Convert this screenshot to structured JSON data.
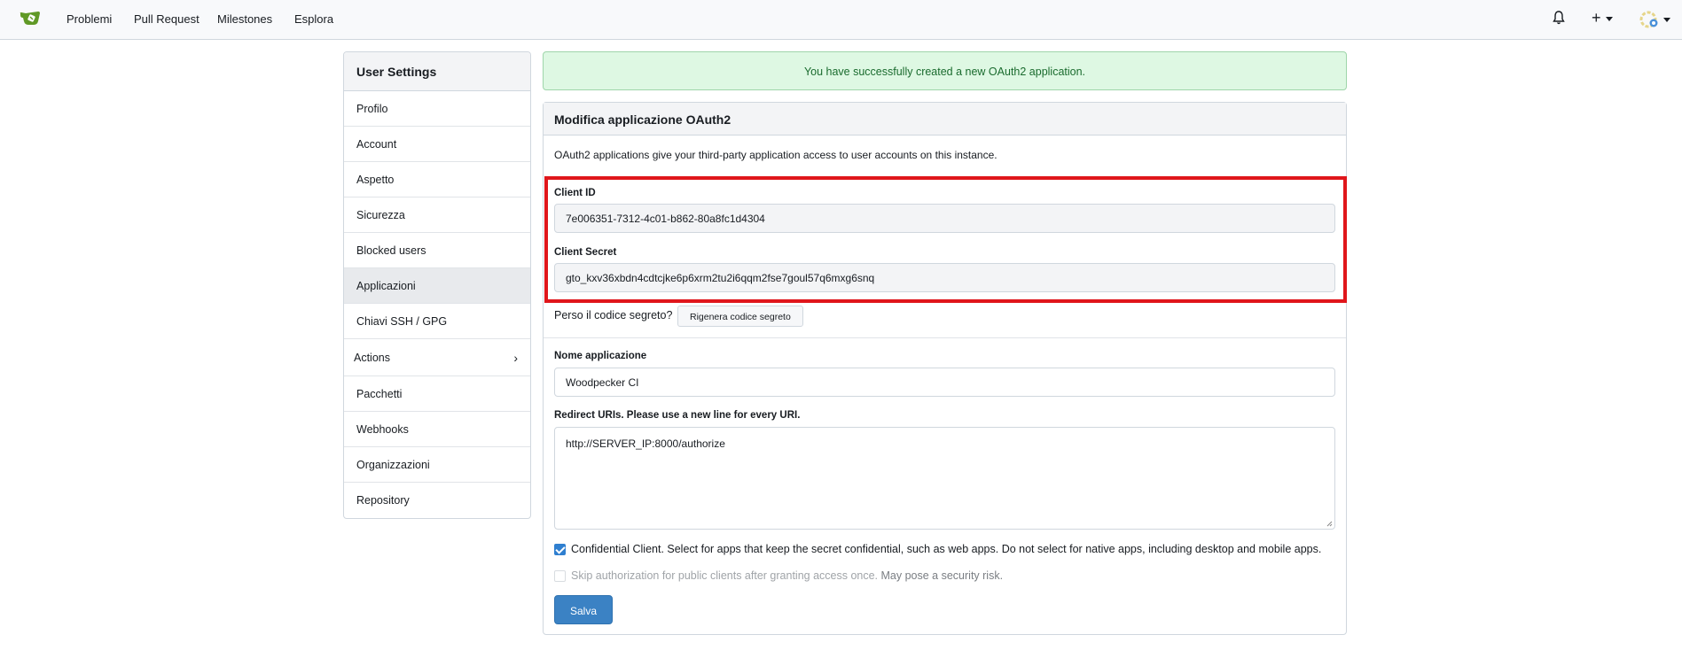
{
  "nav": {
    "links": [
      "Problemi",
      "Pull Request",
      "Milestones",
      "Esplora"
    ],
    "plus_label": "+"
  },
  "sidebar": {
    "title": "User Settings",
    "items": [
      {
        "label": "Profilo"
      },
      {
        "label": "Account"
      },
      {
        "label": "Aspetto"
      },
      {
        "label": "Sicurezza"
      },
      {
        "label": "Blocked users"
      },
      {
        "label": "Applicazioni",
        "active": true
      },
      {
        "label": "Chiavi SSH / GPG"
      },
      {
        "label": "Actions"
      },
      {
        "label": "Pacchetti"
      },
      {
        "label": "Webhooks"
      },
      {
        "label": "Organizzazioni"
      },
      {
        "label": "Repository"
      }
    ]
  },
  "alert": {
    "message": "You have successfully created a new OAuth2 application."
  },
  "app": {
    "header": "Modifica applicazione OAuth2",
    "description": "OAuth2 applications give your third-party application access to user accounts on this instance.",
    "client_id_label": "Client ID",
    "client_id": "7e006351-7312-4c01-b862-80a8fc1d4304",
    "client_secret_label": "Client Secret",
    "client_secret": "gto_kxv36xbdn4cdtcjke6p6xrm2tu2i6qqm2fse7goul57q6mxg6snq",
    "lost_secret_text": "Perso il codice segreto?",
    "regenerate_label": "Rigenera codice segreto",
    "name_label": "Nome applicazione",
    "name_value": "Woodpecker CI",
    "redirect_label": "Redirect URIs. Please use a new line for every URI.",
    "redirect_value": "http://SERVER_IP:8000/authorize",
    "confidential_label": "Confidential Client. Select for apps that keep the secret confidential, such as web apps. Do not select for native apps, including desktop and mobile apps.",
    "skip_auth_label": "Skip authorization for public clients after granting access once.",
    "skip_auth_risk": "May pose a security risk.",
    "save_label": "Salva"
  },
  "colors": {
    "highlight": "#e0161b",
    "primary": "#3b82c4",
    "alert_bg": "#def8e3"
  }
}
